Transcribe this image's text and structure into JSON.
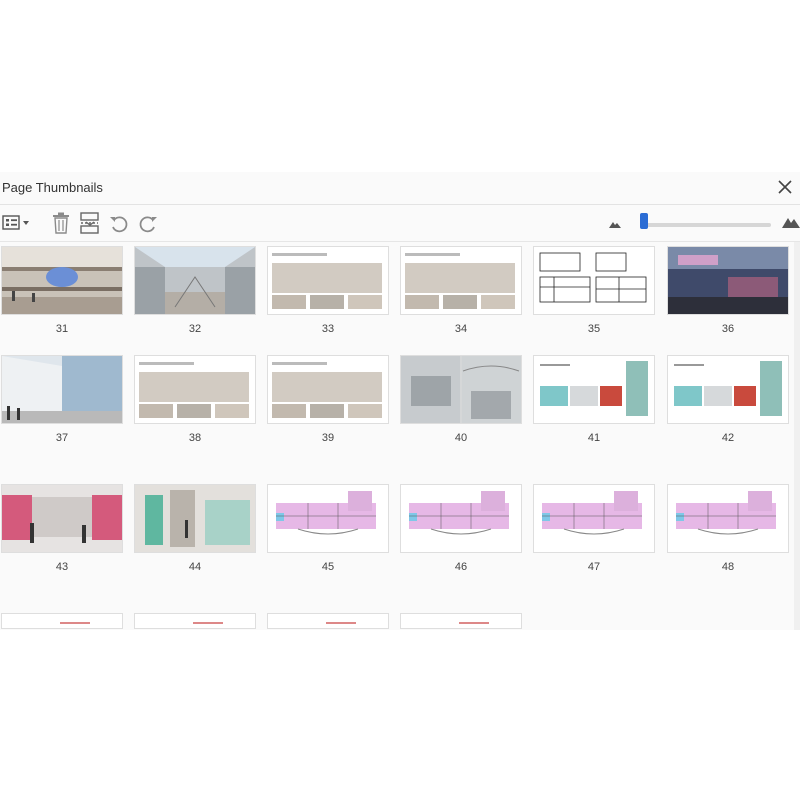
{
  "panel": {
    "title": "Page Thumbnails"
  },
  "toolbar": {
    "options_icon": "thumbnail-options-icon",
    "delete_icon": "trash-icon",
    "insert_icon": "insert-pages-icon",
    "rotate_ccw_icon": "rotate-counterclockwise-icon",
    "rotate_cw_icon": "rotate-clockwise-icon",
    "zoom_level": 0.05
  },
  "pages": [
    {
      "number": "31",
      "kind": "photo-mall"
    },
    {
      "number": "32",
      "kind": "photo-atrium"
    },
    {
      "number": "33",
      "kind": "render-board"
    },
    {
      "number": "34",
      "kind": "render-board"
    },
    {
      "number": "35",
      "kind": "drawings"
    },
    {
      "number": "36",
      "kind": "photo-dark"
    },
    {
      "number": "37",
      "kind": "render-lobby"
    },
    {
      "number": "38",
      "kind": "render-board"
    },
    {
      "number": "39",
      "kind": "render-board"
    },
    {
      "number": "40",
      "kind": "render-corridor"
    },
    {
      "number": "41",
      "kind": "material-board"
    },
    {
      "number": "42",
      "kind": "material-board"
    },
    {
      "number": "43",
      "kind": "render-pink"
    },
    {
      "number": "44",
      "kind": "render-teal"
    },
    {
      "number": "45",
      "kind": "floor-plan"
    },
    {
      "number": "46",
      "kind": "floor-plan"
    },
    {
      "number": "47",
      "kind": "floor-plan"
    },
    {
      "number": "48",
      "kind": "floor-plan"
    },
    {
      "number": "",
      "kind": "partial"
    },
    {
      "number": "",
      "kind": "partial"
    },
    {
      "number": "",
      "kind": "partial"
    },
    {
      "number": "",
      "kind": "partial"
    }
  ],
  "colors": {
    "accent": "#2b6cd4",
    "border": "#dedede",
    "icon": "#6b6b6b"
  }
}
